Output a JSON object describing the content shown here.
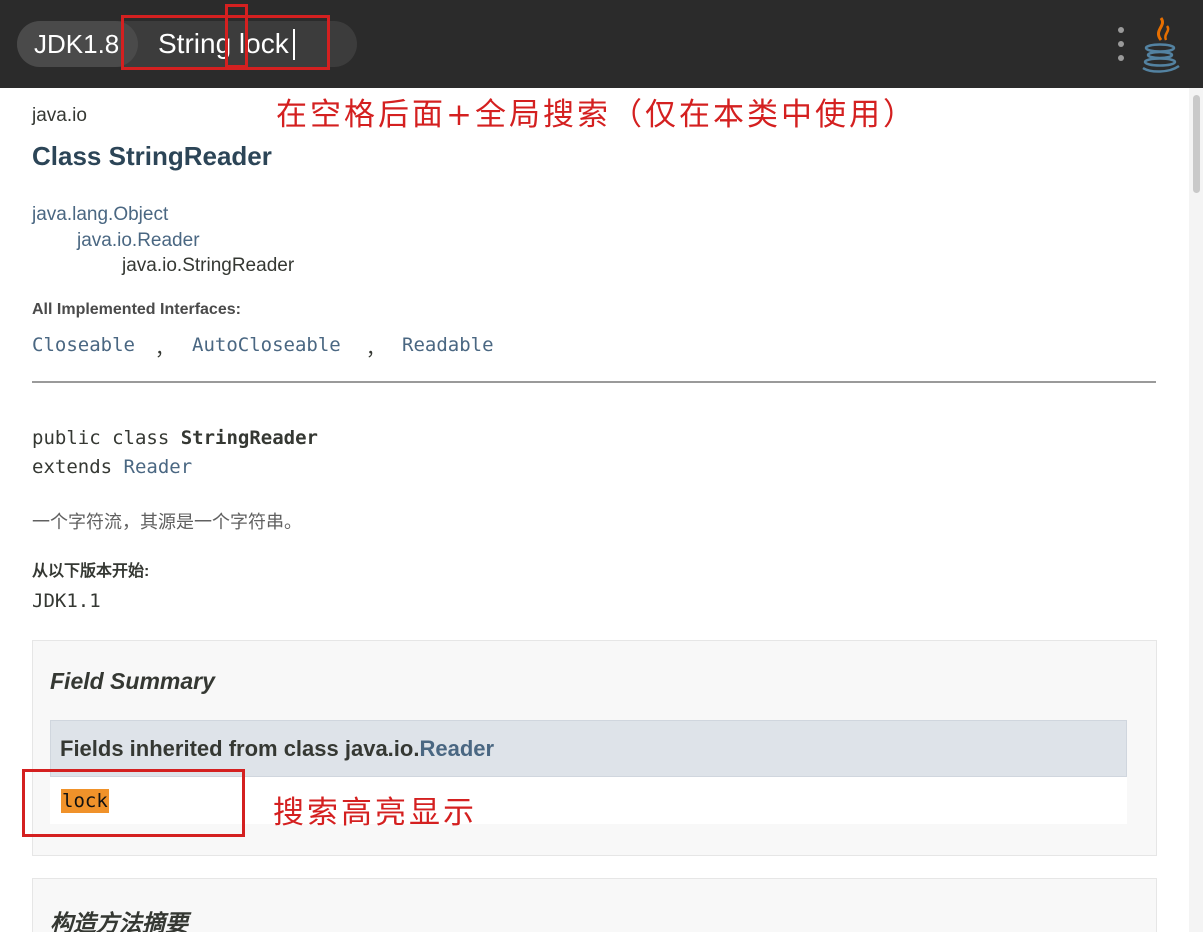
{
  "topbar": {
    "version_badge": "JDK1.8",
    "search_value": "String lock",
    "menu_icon": "kebab-menu-icon",
    "logo_icon": "java-logo-icon"
  },
  "annotations": {
    "search_hint": "在空格后面+全局搜索（仅在本类中使用）",
    "highlight_hint": "搜索高亮显示",
    "color": "#d42020"
  },
  "doc": {
    "package": "java.io",
    "class_title": "Class StringReader",
    "inheritance": [
      "java.lang.Object",
      "java.io.Reader",
      "java.io.StringReader"
    ],
    "interfaces_label": "All Implemented Interfaces:",
    "interfaces": [
      "Closeable",
      "AutoCloseable",
      "Readable"
    ],
    "interface_sep": "，",
    "declaration": {
      "line1_prefix": "public class ",
      "class_name": "StringReader",
      "line2_prefix": "extends ",
      "superclass": "Reader"
    },
    "description": "一个字符流，其源是一个字符串。",
    "since_label": "从以下版本开始:",
    "since_value": "JDK1.1",
    "field_summary": {
      "title": "Field Summary",
      "inherited_prefix": "Fields inherited from class java.io.",
      "inherited_class": "Reader",
      "fields": [
        "lock"
      ]
    },
    "constructor_summary_title": "构造方法摘要"
  },
  "colors": {
    "link": "#4a6782",
    "highlight": "#f0922a",
    "topbar": "#2b2b2b"
  }
}
